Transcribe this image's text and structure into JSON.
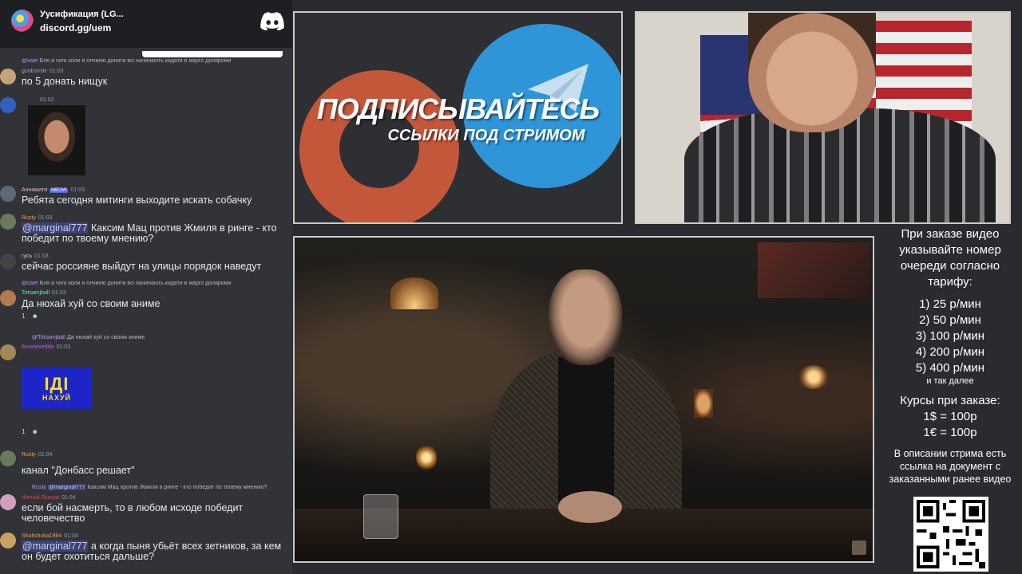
{
  "invite": {
    "name": "Уусификация (LG...",
    "link": "discord.gg/uem"
  },
  "promo": {
    "title": "ПОДПИСЫВАЙТЕСЬ",
    "subtitle": "ССЫЛКИ ПОД СТРИМОМ"
  },
  "chat": {
    "messages": [
      {
        "reply": "Бля а чого коли я плчиню донити всі начинають кидати в марго доляроми",
        "author": "goobsmile",
        "time": "01:03",
        "text": "по 5 донать нищук"
      },
      {
        "author": "",
        "time": "01:02",
        "text": ""
      },
      {
        "author": "Аннамити",
        "badge": "MEOW",
        "time": "01:03",
        "text": "Ребята сегодня митинги выходите искать собачку"
      },
      {
        "author": "Rusty",
        "time": "01:03",
        "mention": "@marginal777",
        "text": " Каксим Мац против Жмиля в ринге - кто победит по твоему мнению?"
      },
      {
        "author": "гусь",
        "time": "01:03",
        "text": "сейчас россияне выйдут на улицы порядок наведут"
      },
      {
        "reply": "Бля а чого коли я плчиню донити всі начинають кидати в марго доляроми",
        "author": "Totsamjball",
        "time": "01:03",
        "text": "Да нюхай хуй со своим аниме",
        "reactions": [
          "1",
          "☻"
        ]
      },
      {
        "reply_author": "@Totsamjball",
        "reply": "Да нюхай хуй со своим аниме",
        "author": "Arseniivedda",
        "time": "01:03",
        "text": ""
      },
      {
        "reactions": [
          "1",
          "☻"
        ]
      },
      {
        "author": "Rusty",
        "time": "01:04",
        "text": "канал \"Донбасс решает\""
      },
      {
        "reply_author": "Rusty",
        "reply_mention": "@marginal777",
        "reply": "Каксим Мац против Жмиля в ринге - кто победит по твоему мнению?",
        "author": "Житый Льосик",
        "time": "01:04",
        "text": "если бой насмерть, то в любом исходе победит человечество"
      },
      {
        "author": "Shakshuka1984",
        "time": "01:04",
        "mention": "@marginal777",
        "text": " а когда пыня убьёт всех зетников, за кем он будет охотиться дальше?"
      }
    ],
    "idi_image": {
      "big": "ІДІ",
      "small": "НАХУЙ"
    }
  },
  "info": {
    "intro": "При заказе видео указывайте номер очереди согласно тарифу:",
    "rates": [
      "1) 25 р/мин",
      "2) 50 р/мин",
      "3) 100 р/мин",
      "4) 200 р/мин",
      "5) 400 р/мин"
    ],
    "etc": "и так далее",
    "courses_title": "Курсы при заказе:",
    "courses": [
      "1$ = 100р",
      "1€ = 100р"
    ],
    "description": "В описании стрима есть ссылка на документ с заказанными ранее видео"
  },
  "colors": {
    "chat_bg": "#323339",
    "mention_bg": "#3d4270",
    "telegram_blue": "#2e96d8",
    "patreon_orange": "#c4573a"
  }
}
